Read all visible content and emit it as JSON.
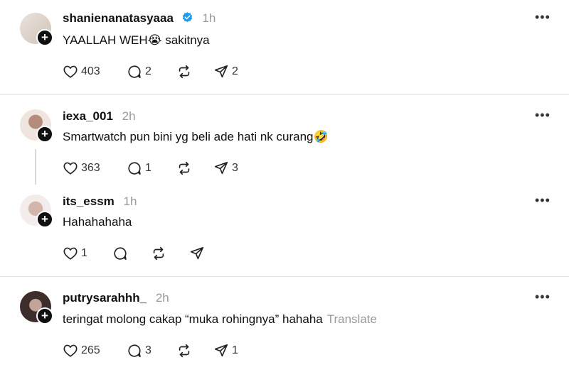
{
  "posts": [
    {
      "username": "shanienanatasyaaa",
      "verified": true,
      "time": "1h",
      "text": "YAALLAH WEH😭 sakitnya",
      "likes": "403",
      "replies": "2",
      "reposts": "",
      "shares": "2",
      "avatar_colors": [
        "#d9cfc4",
        "#f1ede8"
      ]
    },
    {
      "username": "iexa_001",
      "verified": false,
      "time": "2h",
      "text": "Smartwatch pun bini yg beli ade hati nk curang🤣",
      "likes": "363",
      "replies": "1",
      "reposts": "",
      "shares": "3",
      "avatar_colors": [
        "#caa99c",
        "#efe3dc"
      ]
    },
    {
      "username": "its_essm",
      "verified": false,
      "time": "1h",
      "text": "Hahahahaha",
      "likes": "1",
      "replies": "",
      "reposts": "",
      "shares": "",
      "avatar_colors": [
        "#d8c7c2",
        "#f3eeec"
      ]
    },
    {
      "username": "putrysarahhh_",
      "verified": false,
      "time": "2h",
      "text": "teringat molong cakap “muka rohingnya” hahaha",
      "translate": "Translate",
      "likes": "265",
      "replies": "3",
      "reposts": "",
      "shares": "1",
      "avatar_colors": [
        "#5a4540",
        "#c9b3ab"
      ]
    }
  ],
  "icons": {
    "like": "heart-icon",
    "reply": "comment-icon",
    "repost": "repost-icon",
    "share": "send-icon",
    "more": "more-icon",
    "follow": "plus-icon",
    "verified": "verified-badge-icon"
  },
  "colors": {
    "verified": "#1d9bf0",
    "muted": "#999999",
    "divider": "#e5e5e5"
  }
}
